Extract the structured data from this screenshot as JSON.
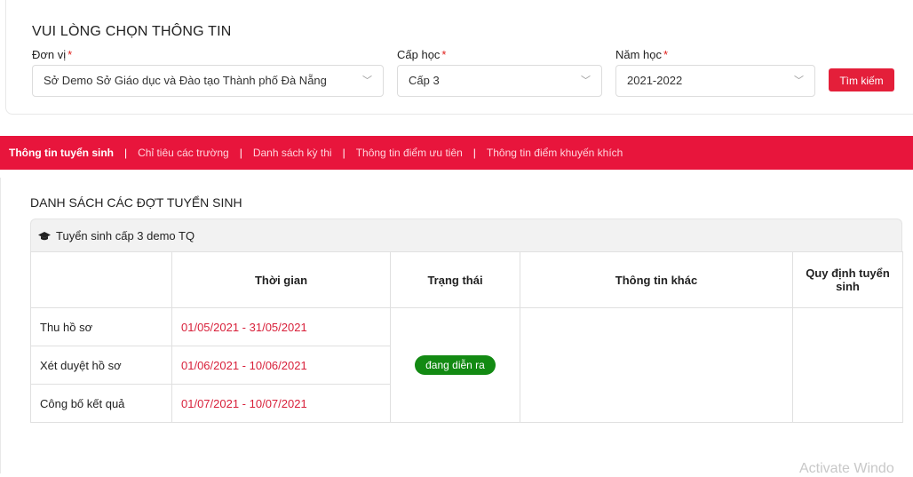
{
  "filter": {
    "title": "VUI LÒNG CHỌN THÔNG TIN",
    "unit_label": "Đơn vị",
    "unit_value": "Sở Demo Sở Giáo dục và Đào tạo Thành phố Đà Nẵng",
    "level_label": "Cấp học",
    "level_value": "Cấp 3",
    "year_label": "Năm học",
    "year_value": "2021-2022",
    "required_mark": "*",
    "search_label": "Tìm kiếm",
    "chevron": "﹀"
  },
  "tabs": [
    {
      "label": "Thông tin tuyển sinh",
      "active": true
    },
    {
      "label": "Chỉ tiêu các trường",
      "active": false
    },
    {
      "label": "Danh sách kỳ thi",
      "active": false
    },
    {
      "label": "Thông tin điểm ưu tiên",
      "active": false
    },
    {
      "label": "Thông tin điểm khuyến khích",
      "active": false
    }
  ],
  "tab_separator": "|",
  "section": {
    "title": "DANH SÁCH CÁC ĐỢT TUYỂN SINH",
    "panel_title": "Tuyển sinh cấp 3 demo TQ",
    "panel_icon": "graduation-cap-icon"
  },
  "table": {
    "headers": [
      "",
      "Thời gian",
      "Trạng thái",
      "Thông tin khác",
      "Quy định tuyển sinh"
    ],
    "rows": [
      {
        "stage": "Thu hồ sơ",
        "period": "01/05/2021 - 31/05/2021"
      },
      {
        "stage": "Xét duyệt hồ sơ",
        "period": "01/06/2021 - 10/06/2021"
      },
      {
        "stage": "Công bố kết quả",
        "period": "01/07/2021 - 10/07/2021"
      }
    ],
    "status": "đang diễn ra"
  },
  "watermark": "Activate Windo",
  "colors": {
    "accent": "#e8153c",
    "button": "#e41f3a",
    "period_text": "#d8203a",
    "status_badge": "#138a13"
  }
}
